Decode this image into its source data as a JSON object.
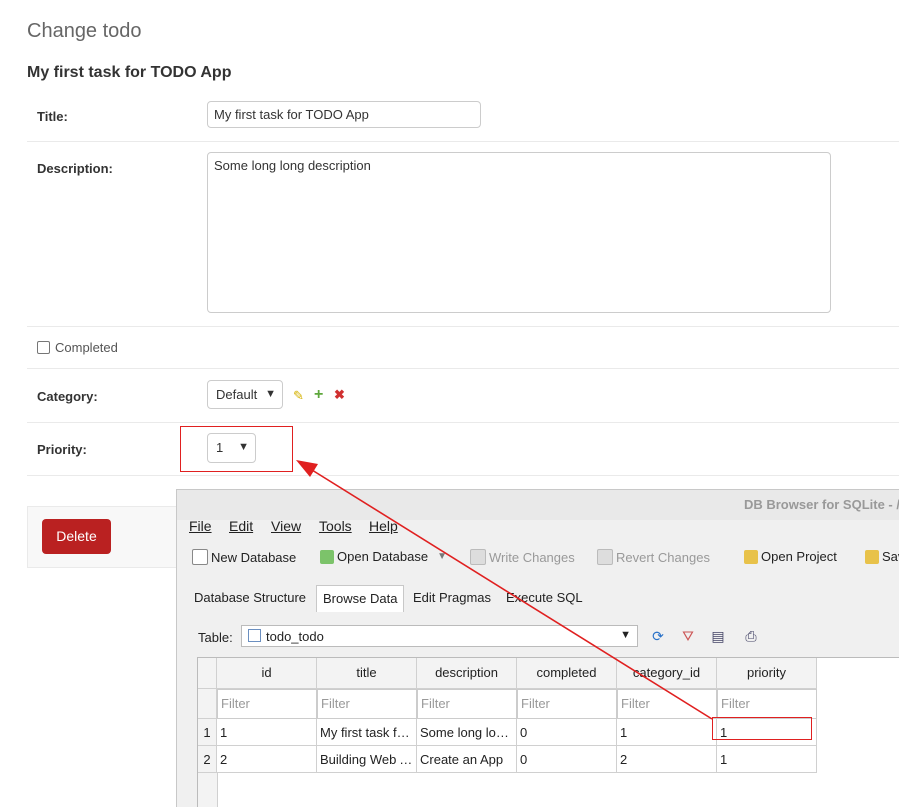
{
  "admin": {
    "heading": "Change todo",
    "object_title": "My first task for TODO App",
    "title_label": "Title:",
    "title_value": "My first task for TODO App",
    "description_label": "Description:",
    "description_value": "Some long long description",
    "completed_label": "Completed",
    "category_label": "Category:",
    "category_value": "Default",
    "priority_label": "Priority:",
    "priority_value": "1",
    "delete_label": "Delete"
  },
  "dbbrowser": {
    "window_title": "DB Browser for SQLite - /",
    "menu": [
      "File",
      "Edit",
      "View",
      "Tools",
      "Help"
    ],
    "toolbar": {
      "new_db": "New Database",
      "open_db": "Open Database",
      "write": "Write Changes",
      "revert": "Revert Changes",
      "open_project": "Open Project",
      "save": "Sav"
    },
    "tabs": [
      "Database Structure",
      "Browse Data",
      "Edit Pragmas",
      "Execute SQL"
    ],
    "table_label": "Table:",
    "table_value": "todo_todo",
    "columns": [
      "id",
      "title",
      "description",
      "completed",
      "category_id",
      "priority"
    ],
    "filter_placeholder": "Filter",
    "rows": [
      {
        "num": "1",
        "cells": [
          "1",
          "My first task for TODO App",
          "Some long long description",
          "0",
          "1",
          "1"
        ]
      },
      {
        "num": "2",
        "cells": [
          "2",
          "Building Web App",
          "Create an App",
          "0",
          "2",
          "1"
        ]
      }
    ]
  },
  "colors": {
    "delete": "#ba2121",
    "highlight": "#e02020",
    "edit_icon": "#d4b100",
    "add_icon": "#5ea73c",
    "remove_icon": "#d03030"
  }
}
